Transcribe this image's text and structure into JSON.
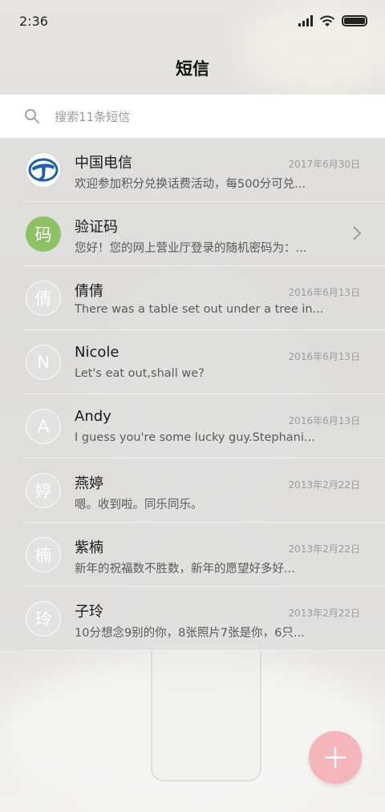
{
  "status_bar": {
    "time": "2:36",
    "icons": [
      "signal-icon",
      "wifi-icon",
      "battery-icon"
    ]
  },
  "header": {
    "title": "短信"
  },
  "search": {
    "placeholder": "搜索11条短信",
    "icon": "search-icon"
  },
  "messages": [
    {
      "avatar": "中国电信",
      "avatar_type": "logo",
      "name": "中国电信",
      "date": "2017年6月30日",
      "preview": "欢迎参加积分兑换话费活动，每500分可兑..."
    },
    {
      "avatar": "码",
      "avatar_type": "green",
      "name": "验证码",
      "date": "",
      "preview": "您好！您的网上营业厅登录的随机密码为：..."
    },
    {
      "avatar": "倩",
      "avatar_type": "ghost",
      "name": "倩倩",
      "date": "2016年6月13日",
      "preview": "There was a table set out under a tree in..."
    },
    {
      "avatar": "N",
      "avatar_type": "ghost",
      "name": "Nicole",
      "date": "2016年6月13日",
      "preview": "Let's eat out,shall we?"
    },
    {
      "avatar": "A",
      "avatar_type": "ghost",
      "name": "Andy",
      "date": "2016年6月13日",
      "preview": "I guess you're some lucky guy.Stephani..."
    },
    {
      "avatar": "婷",
      "avatar_type": "ghost",
      "name": "燕婷",
      "date": "2013年2月22日",
      "preview": "嗯。收到啦。同乐同乐。"
    },
    {
      "avatar": "楠",
      "avatar_type": "ghost",
      "name": "紫楠",
      "date": "2013年2月22日",
      "preview": "新年的祝福数不胜数，新年的愿望好多好..."
    },
    {
      "avatar": "玲",
      "avatar_type": "ghost",
      "name": "子玲",
      "date": "2013年2月22日",
      "preview": "10分想念9别的你，8张照片7张是你，6只..."
    }
  ],
  "fab": {
    "icon": "plus-icon"
  },
  "colors": {
    "accent_fab": "#f5b6bb",
    "avatar_green": "#8cc263",
    "telecom_blue": "#1d5fb0"
  }
}
